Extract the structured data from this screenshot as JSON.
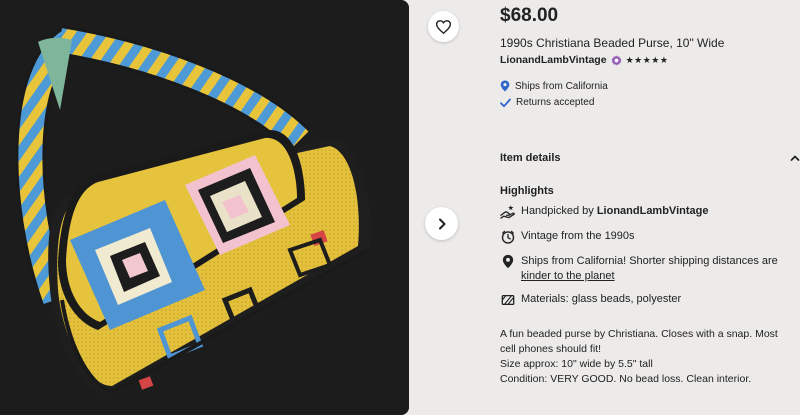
{
  "listing": {
    "price": "$68.00",
    "title": "1990s Christiana Beaded Purse, 10\" Wide",
    "seller": "LionandLambVintage",
    "rating_stars": "★★★★★",
    "ships_from": "Ships from California",
    "returns": "Returns accepted"
  },
  "item_details": {
    "label": "Item details"
  },
  "highlights": {
    "heading": "Highlights",
    "handpicked_prefix": "Handpicked by ",
    "handpicked_seller": "LionandLambVintage",
    "vintage": "Vintage from the 1990s",
    "ships_text": "Ships from California! Shorter shipping distances are ",
    "ships_link": "kinder to the planet",
    "materials": "Materials: glass beads, polyester"
  },
  "description": {
    "line1": "A fun beaded purse by Christiana. Closes with a snap. Most cell phones should fit!",
    "line2": "Size approx: 10\" wide by 5.5\" tall",
    "line3": "Condition: VERY GOOD. No bead loss. Clean interior."
  },
  "icons": {
    "favorite": "heart-icon",
    "next": "chevron-right-icon",
    "seller_badge": "star-seller-badge-icon",
    "location": "location-pin-icon",
    "returns": "checkmark-icon",
    "collapse": "chevron-up-icon",
    "handpicked": "hand-icon",
    "vintage": "clock-icon",
    "ships": "location-pin-icon",
    "materials": "materials-icon"
  },
  "colors": {
    "background": "#ecebea",
    "text": "#222222",
    "badge": "#9560b8",
    "accent_blue": "#2f66c9"
  }
}
